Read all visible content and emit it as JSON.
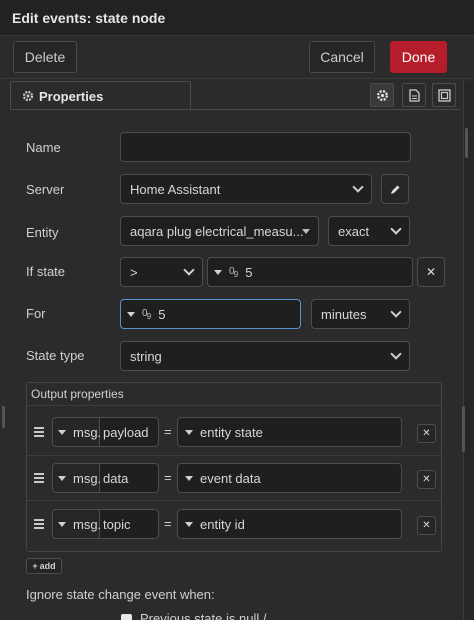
{
  "window": {
    "title": "Edit events: state node"
  },
  "toolbar": {
    "delete_label": "Delete",
    "cancel_label": "Cancel",
    "done_label": "Done",
    "done_color": "#b51d2a"
  },
  "tabs": {
    "properties_label": "Properties",
    "icons": [
      "gear-icon",
      "document-icon",
      "layout-icon"
    ]
  },
  "form": {
    "name_label": "Name",
    "name_value": "",
    "server_label": "Server",
    "server_value": "Home Assistant",
    "entity_label": "Entity",
    "entity_value": "aqara plug electrical_measu...",
    "entity_match": "exact",
    "ifstate_label": "If state",
    "ifstate_operator": ">",
    "ifstate_value": "5",
    "for_label": "For",
    "for_value": "5",
    "for_unit": "minutes",
    "statetype_label": "State type",
    "statetype_value": "string"
  },
  "output": {
    "title": "Output properties",
    "msg_prefix": "msg.",
    "equals": "=",
    "rows": [
      {
        "property": "payload",
        "value": "entity state"
      },
      {
        "property": "data",
        "value": "event data"
      },
      {
        "property": "topic",
        "value": "entity id"
      }
    ],
    "add_label": "add"
  },
  "ignore": {
    "label": "Ignore state change event when:",
    "first_option_partial": "Previous state is null / ..."
  }
}
